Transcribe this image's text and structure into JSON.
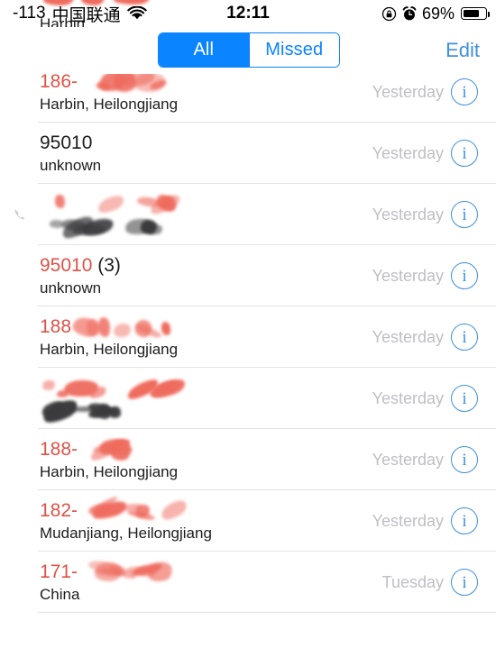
{
  "status_bar": {
    "signal_value": "-113",
    "carrier": "中国联通",
    "wifi_icon": "wifi-icon",
    "time": "12:11",
    "rotation_lock_icon": "rotation-lock-icon",
    "alarm_icon": "alarm-clock-icon",
    "battery_percent": "69%",
    "battery_icon": "battery-icon",
    "battery_level": 69
  },
  "nav": {
    "segments": [
      {
        "label": "All",
        "selected": true
      },
      {
        "label": "Missed",
        "selected": false
      }
    ],
    "edit_label": "Edit"
  },
  "colors": {
    "ios_blue": "#0a84ff",
    "edit_blue": "#3e8fdd",
    "missed_red": "#dd5247",
    "time_gray": "#bfbfc4",
    "separator": "#e3e3e6"
  },
  "list": {
    "partial_row_top": {
      "sub": "Harbin",
      "redacted_title": true
    },
    "rows": [
      {
        "title_prefix": "186-",
        "title_redacted": true,
        "missed": true,
        "sub": "Harbin, Heilongjiang",
        "sub_redacted": false,
        "time": "Yesterday",
        "info_icon": "info-icon",
        "outgoing_icon": false
      },
      {
        "title_prefix": "95010",
        "title_redacted": false,
        "missed": false,
        "sub": "unknown",
        "sub_redacted": false,
        "time": "Yesterday",
        "info_icon": "info-icon",
        "outgoing_icon": false
      },
      {
        "title_prefix": "",
        "title_redacted": true,
        "missed": false,
        "sub": "",
        "sub_redacted": true,
        "time": "Yesterday",
        "info_icon": "info-icon",
        "outgoing_icon": true
      },
      {
        "title_prefix": "95010",
        "title_count": "(3)",
        "title_redacted": false,
        "missed": true,
        "sub": "unknown",
        "sub_redacted": false,
        "time": "Yesterday",
        "info_icon": "info-icon",
        "outgoing_icon": false
      },
      {
        "title_prefix": "188",
        "title_redacted": true,
        "missed": true,
        "sub": "Harbin, Heilongjiang",
        "sub_redacted": false,
        "time": "Yesterday",
        "info_icon": "info-icon",
        "outgoing_icon": false
      },
      {
        "title_prefix": "",
        "title_redacted": true,
        "missed": true,
        "sub": "",
        "sub_redacted": true,
        "time": "Yesterday",
        "info_icon": "info-icon",
        "outgoing_icon": false
      },
      {
        "title_prefix": "188-",
        "title_redacted": true,
        "missed": true,
        "sub": "Harbin, Heilongjiang",
        "sub_redacted": false,
        "time": "Yesterday",
        "info_icon": "info-icon",
        "outgoing_icon": false
      },
      {
        "title_prefix": "182-",
        "title_redacted": true,
        "missed": true,
        "sub": "Mudanjiang, Heilongjiang",
        "sub_redacted": false,
        "time": "Yesterday",
        "info_icon": "info-icon",
        "outgoing_icon": false
      },
      {
        "title_prefix": "171-",
        "title_redacted": true,
        "missed": true,
        "sub": "China",
        "sub_redacted": false,
        "time": "Tuesday",
        "info_icon": "info-icon",
        "outgoing_icon": false
      }
    ]
  }
}
